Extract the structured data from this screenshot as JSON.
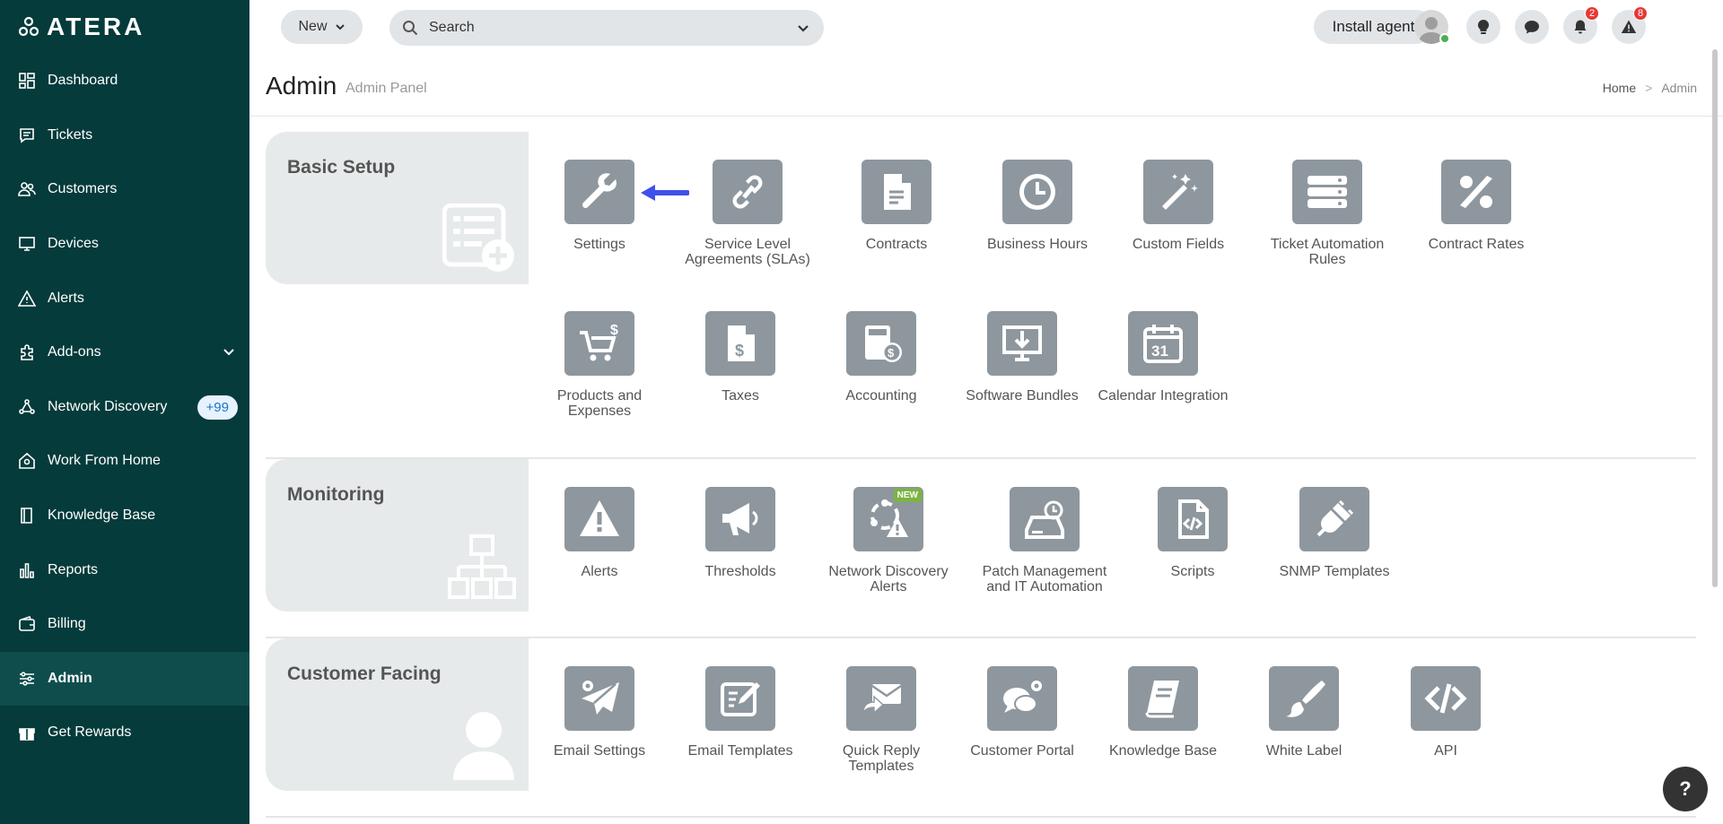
{
  "app": {
    "logo_text": "ATERA"
  },
  "sidebar": {
    "items": [
      {
        "label": "Dashboard",
        "icon": "dashboard-icon"
      },
      {
        "label": "Tickets",
        "icon": "tickets-icon"
      },
      {
        "label": "Customers",
        "icon": "customers-icon"
      },
      {
        "label": "Devices",
        "icon": "devices-icon"
      },
      {
        "label": "Alerts",
        "icon": "alerts-icon"
      },
      {
        "label": "Add-ons",
        "icon": "puzzle-icon"
      },
      {
        "label": "Network Discovery",
        "icon": "network-icon",
        "badge": "+99"
      },
      {
        "label": "Work From Home",
        "icon": "home-icon"
      },
      {
        "label": "Knowledge Base",
        "icon": "book-icon"
      },
      {
        "label": "Reports",
        "icon": "reports-icon"
      },
      {
        "label": "Billing",
        "icon": "wallet-icon"
      },
      {
        "label": "Admin",
        "icon": "sliders-icon",
        "active": true
      },
      {
        "label": "Get Rewards",
        "icon": "gift-icon"
      }
    ]
  },
  "topbar": {
    "new_label": "New",
    "search_placeholder": "Search",
    "install_label": "Install agent",
    "notifications_count": "2",
    "alerts_count": "8"
  },
  "header": {
    "title": "Admin",
    "subtitle": "Admin Panel",
    "breadcrumb": [
      "Home",
      ">",
      "Admin"
    ]
  },
  "sections": {
    "basic_setup": {
      "title": "Basic Setup",
      "tiles": [
        {
          "label": "Settings"
        },
        {
          "label": "Service Level Agreements (SLAs)"
        },
        {
          "label": "Contracts"
        },
        {
          "label": "Business Hours"
        },
        {
          "label": "Custom Fields"
        },
        {
          "label": "Ticket Automation Rules"
        },
        {
          "label": "Contract Rates"
        },
        {
          "label": "Products and Expenses"
        },
        {
          "label": "Taxes"
        },
        {
          "label": "Accounting"
        },
        {
          "label": "Software Bundles"
        },
        {
          "label": "Calendar Integration"
        }
      ]
    },
    "monitoring": {
      "title": "Monitoring",
      "tiles": [
        {
          "label": "Alerts"
        },
        {
          "label": "Thresholds"
        },
        {
          "label": "Network Discovery Alerts",
          "tag": "NEW"
        },
        {
          "label": "Patch Management and IT Automation"
        },
        {
          "label": "Scripts"
        },
        {
          "label": "SNMP Templates"
        }
      ]
    },
    "customer_facing": {
      "title": "Customer Facing",
      "tiles": [
        {
          "label": "Email Settings"
        },
        {
          "label": "Email Templates"
        },
        {
          "label": "Quick Reply Templates"
        },
        {
          "label": "Customer Portal"
        },
        {
          "label": "Knowledge Base"
        },
        {
          "label": "White Label"
        },
        {
          "label": "API"
        }
      ]
    }
  },
  "help": {
    "label": "?"
  }
}
